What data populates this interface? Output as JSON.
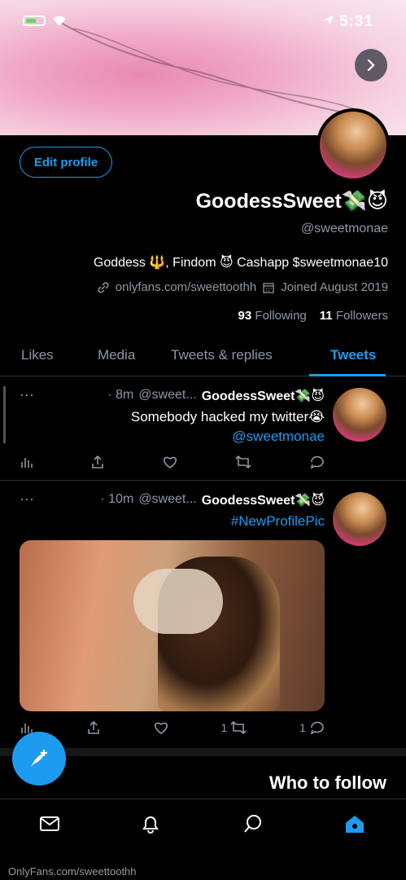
{
  "status_bar": {
    "time": "5:31"
  },
  "profile": {
    "edit_button": "Edit profile",
    "display_name": "GoodessSweet💸😈",
    "handle": "@sweetmonae",
    "bio": "Goddess 🔱, Findom 😈 Cashapp $sweetmonae10",
    "link": "onlyfans.com/sweettoothh",
    "joined": "Joined August 2019",
    "following_count": "93",
    "following_label": "Following",
    "followers_count": "11",
    "followers_label": "Followers"
  },
  "tabs": [
    "Tweets",
    "Tweets & replies",
    "Media",
    "Likes"
  ],
  "tweets": [
    {
      "name": "GoodessSweet💸😈",
      "handle": "@sweet...",
      "time": "· 8m",
      "text": "Somebody hacked my twitter😭",
      "mention": "@sweetmonae"
    },
    {
      "name": "GoodessSweet💸😈",
      "handle": "@sweet...",
      "time": "· 10m",
      "hashtag": "#NewProfilePic",
      "reply_count": "1",
      "retweet_count": "1"
    }
  ],
  "who_to_follow": "Who to follow",
  "watermark": "OnlyFans.com/sweettoothh",
  "colors": {
    "accent": "#1d9bf0",
    "background": "#000000",
    "muted": "#8b98a5"
  }
}
